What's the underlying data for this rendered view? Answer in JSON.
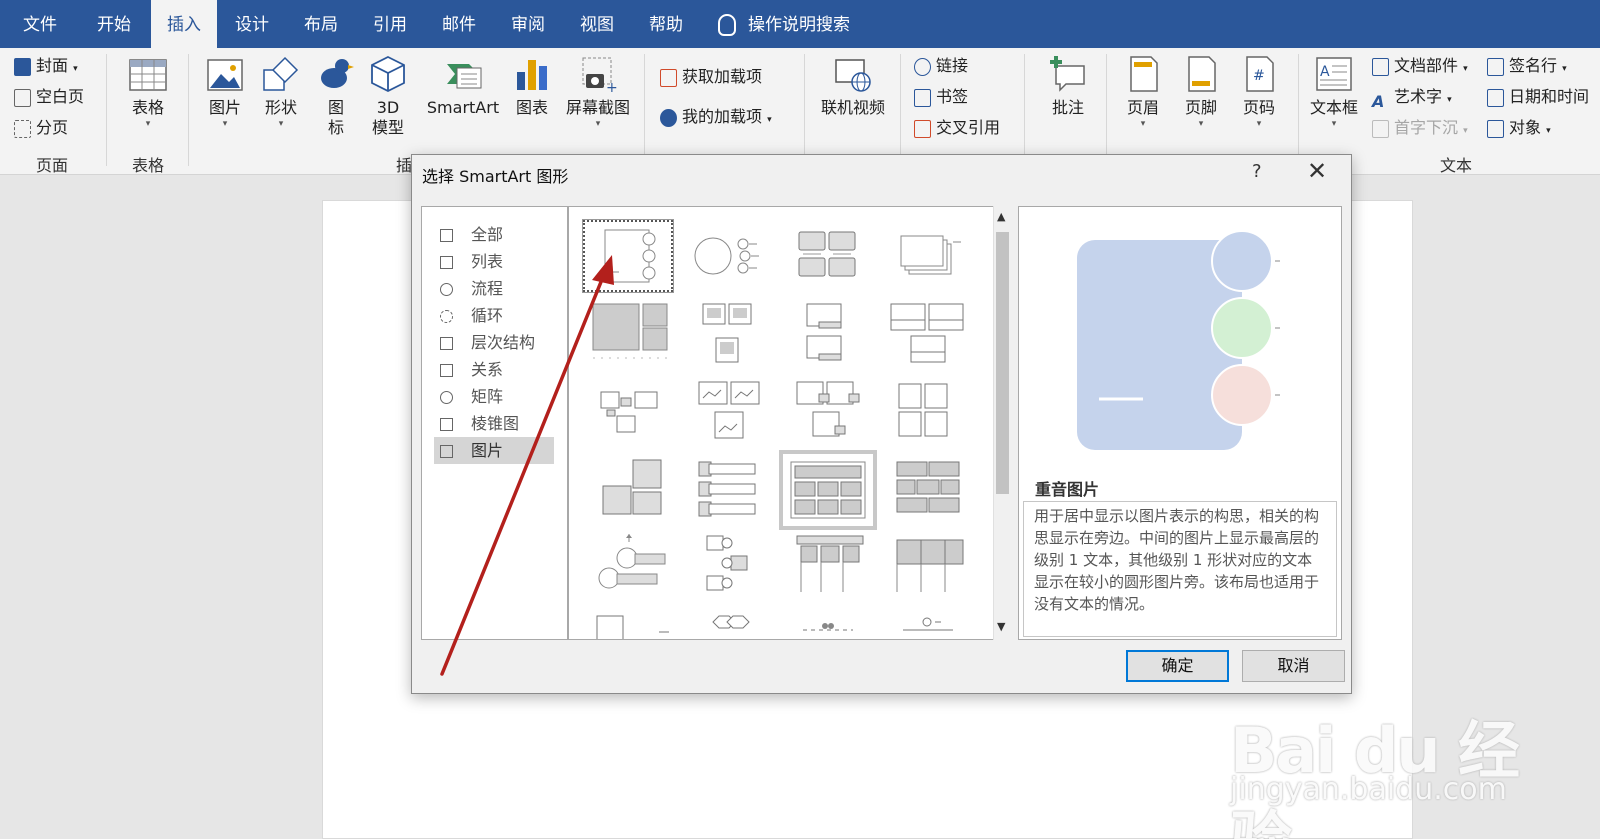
{
  "tabs": [
    {
      "label": "文件",
      "active": false
    },
    {
      "label": "开始",
      "active": false
    },
    {
      "label": "插入",
      "active": true
    },
    {
      "label": "设计",
      "active": false
    },
    {
      "label": "布局",
      "active": false
    },
    {
      "label": "引用",
      "active": false
    },
    {
      "label": "邮件",
      "active": false
    },
    {
      "label": "审阅",
      "active": false
    },
    {
      "label": "视图",
      "active": false
    },
    {
      "label": "帮助",
      "active": false
    }
  ],
  "search_label": "操作说明搜索",
  "ribbon": {
    "pages": {
      "cover": "封面",
      "blank": "空白页",
      "break": "分页",
      "group": "页面"
    },
    "table": {
      "label": "表格",
      "group": "表格"
    },
    "illustrations": {
      "picture": "图片",
      "shapes": "形状",
      "icons_1": "图",
      "icons_2": "标",
      "model_1": "3D",
      "model_2": "模型",
      "smartart": "SmartArt",
      "chart": "图表",
      "screenshot": "屏幕截图",
      "group_partial": "插"
    },
    "addins": {
      "get": "获取加载项",
      "mine": "我的加载项"
    },
    "media": {
      "online_video": "联机视频"
    },
    "links": {
      "link": "链接",
      "bookmark": "书签",
      "cross_ref": "交叉引用"
    },
    "comments": {
      "comment": "批注"
    },
    "header_footer": {
      "header": "页眉",
      "footer": "页脚",
      "page_number": "页码"
    },
    "text": {
      "textbox": "文本框",
      "quick_parts": "文档部件",
      "wordart": "艺术字",
      "dropcap": "首字下沉",
      "signature": "签名行",
      "datetime": "日期和时间",
      "object": "对象",
      "group": "文本"
    }
  },
  "dialog": {
    "title": "选择 SmartArt 图形",
    "help": "?",
    "close": "✕",
    "categories": [
      {
        "label": "全部",
        "selected": false
      },
      {
        "label": "列表",
        "selected": false
      },
      {
        "label": "流程",
        "selected": false
      },
      {
        "label": "循环",
        "selected": false
      },
      {
        "label": "层次结构",
        "selected": false
      },
      {
        "label": "关系",
        "selected": false
      },
      {
        "label": "矩阵",
        "selected": false
      },
      {
        "label": "棱锥图",
        "selected": false
      },
      {
        "label": "图片",
        "selected": true
      }
    ],
    "preview_title": "重音图片",
    "preview_desc": "用于居中显示以图片表示的构思，相关的构思显示在旁边。中间的图片上显示最高层的级别 1 文本，其他级别 1 形状对应的文本显示在较小的圆形图片旁。该布局也适用于没有文本的情况。",
    "ok": "确定",
    "cancel": "取消"
  },
  "watermark": {
    "logo": "Bai du 经验",
    "url": "jingyan.baidu.com"
  },
  "colors": {
    "brand": "#2b579a",
    "arrow": "#b3201c",
    "preview_main": "#c5d3ec",
    "preview_c1": "#c5d3ec",
    "preview_c2": "#d3f0d3",
    "preview_c3": "#f6dfdb"
  }
}
